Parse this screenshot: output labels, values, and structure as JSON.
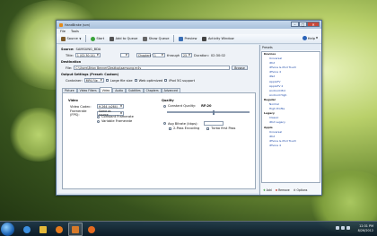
{
  "window": {
    "title": "HandBrake (svn)",
    "controls": {
      "minimize": "–",
      "maximize": "□",
      "close": "✕"
    }
  },
  "menu": [
    "File",
    "Tools"
  ],
  "toolbar": {
    "source": "Source",
    "start": "Start",
    "add_to_queue": "Add to Queue",
    "show_queue": "Show Queue",
    "preview": "Preview",
    "activity_window": "Activity Window",
    "help": "Help"
  },
  "source": {
    "label": "Source:",
    "value": "SAMSUNG_BDA",
    "title_label": "Title:",
    "title_value": "1 (02:30:14)",
    "angle_label": "",
    "chapters_value": "Chapters",
    "from_value": "1",
    "through_label": "through",
    "to_value": "25",
    "duration_label": "Duration:",
    "duration_value": "02:30:02"
  },
  "destination": {
    "label": "Destination",
    "file_label": "File:",
    "file_value": "C:\\Users\\Brian Benner\\Desktop\\samsung.m4v",
    "browse": "Browse"
  },
  "output": {
    "label": "Output Settings (Preset: Custom)",
    "container_label": "Container:",
    "container_value": "MP4 File",
    "large_file": "Large file size",
    "web_optimized": "Web optimized",
    "ipod_support": "iPod 5G support"
  },
  "tabs": [
    "Picture",
    "Video Filters",
    "Video",
    "Audio",
    "Subtitles",
    "Chapters",
    "Advanced"
  ],
  "active_tab": "Video",
  "video": {
    "heading": "Video",
    "codec_label": "Video Codec:",
    "codec_value": "H.264 (x264)",
    "fps_label": "Framerate (FPS):",
    "fps_value": "Same as source",
    "constant_fr": "Constant Framerate",
    "variable_fr": "Variable Framerate",
    "quality_heading": "Quality",
    "cq_label": "Constant Quality:",
    "cq_value": "RF:20",
    "cq_level": 0.55,
    "abr_label": "Avg Bitrate (kbps):",
    "two_pass": "2-Pass Encoding",
    "turbo": "Turbo first Pass"
  },
  "presets": {
    "title": "Presets",
    "items": [
      {
        "label": "Devices",
        "type": "group"
      },
      {
        "label": "Universal",
        "type": "item"
      },
      {
        "label": "iPod",
        "type": "item"
      },
      {
        "label": "iPhone & iPod Touch",
        "type": "item"
      },
      {
        "label": "iPhone 4",
        "type": "item"
      },
      {
        "label": "iPad",
        "type": "item"
      },
      {
        "label": "AppleTV",
        "type": "item"
      },
      {
        "label": "AppleTV 2",
        "type": "item"
      },
      {
        "label": "Android Mid",
        "type": "item"
      },
      {
        "label": "Android High",
        "type": "item"
      },
      {
        "label": "Regular",
        "type": "group"
      },
      {
        "label": "Normal",
        "type": "item"
      },
      {
        "label": "High Profile",
        "type": "item"
      },
      {
        "label": "Legacy",
        "type": "group"
      },
      {
        "label": "Classic",
        "type": "item"
      },
      {
        "label": "iPod Legacy",
        "type": "item"
      },
      {
        "label": "Apple",
        "type": "group"
      },
      {
        "label": "Universal",
        "type": "item"
      },
      {
        "label": "iPod",
        "type": "item"
      },
      {
        "label": "iPhone & iPod Touch",
        "type": "item"
      },
      {
        "label": "iPhone 4",
        "type": "item"
      }
    ],
    "add": "Add",
    "remove": "Remove",
    "options": "Options"
  },
  "taskbar": {
    "time": "12:31 PM",
    "date": "8/26/2012",
    "pinned": [
      "ie-icon",
      "explorer-icon",
      "media-player-icon",
      "handbrake-icon",
      "firefox-icon"
    ]
  },
  "colors": {
    "accent": "#2a63b8",
    "preset_link": "#1d49a8",
    "window_frame": "#4f6c8c"
  }
}
